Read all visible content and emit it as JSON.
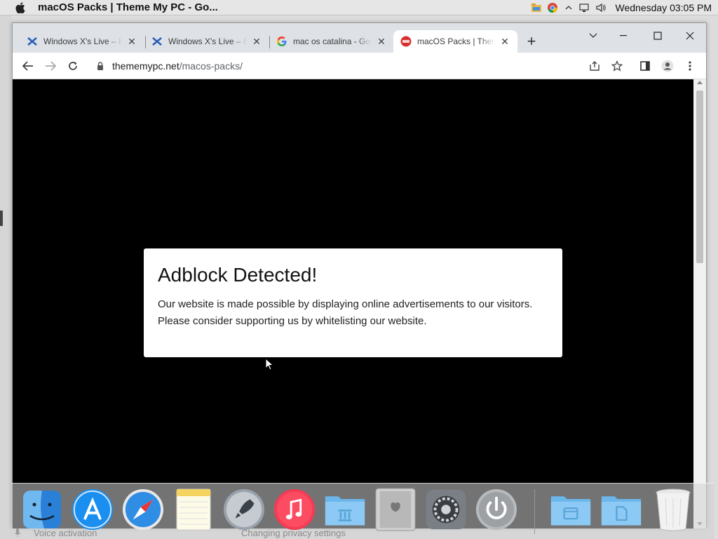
{
  "menubar": {
    "title": "macOS Packs | Theme My PC - Go...",
    "clock": "Wednesday 03:05 PM"
  },
  "tabs": [
    {
      "title": "Windows X's Live – BI",
      "favicon": "windowsx-icon",
      "active": false
    },
    {
      "title": "Windows X's Live – BI",
      "favicon": "windowsx-icon",
      "active": false
    },
    {
      "title": "mac os catalina - Goo",
      "favicon": "google-icon",
      "active": false
    },
    {
      "title": "macOS Packs | Theme",
      "favicon": "thememypc-icon",
      "active": true
    }
  ],
  "address": {
    "domain": "thememypc.net",
    "path": "/macos-packs/"
  },
  "modal": {
    "heading": "Adblock Detected!",
    "line1": "Our website is made possible by displaying online advertisements to our visitors.",
    "line2": "Please consider supporting us by whitelisting our website."
  },
  "dock": {
    "items": [
      "finder-icon",
      "app-store-icon",
      "safari-icon",
      "notes-icon",
      "launchpad-icon",
      "itunes-icon",
      "applications-folder-icon",
      "mac-pro-icon",
      "system-preferences-icon",
      "power-icon",
      "downloads-folder-icon",
      "documents-folder-icon",
      "trash-icon"
    ]
  },
  "status": {
    "left": "Voice activation",
    "center": "Changing privacy settings"
  }
}
